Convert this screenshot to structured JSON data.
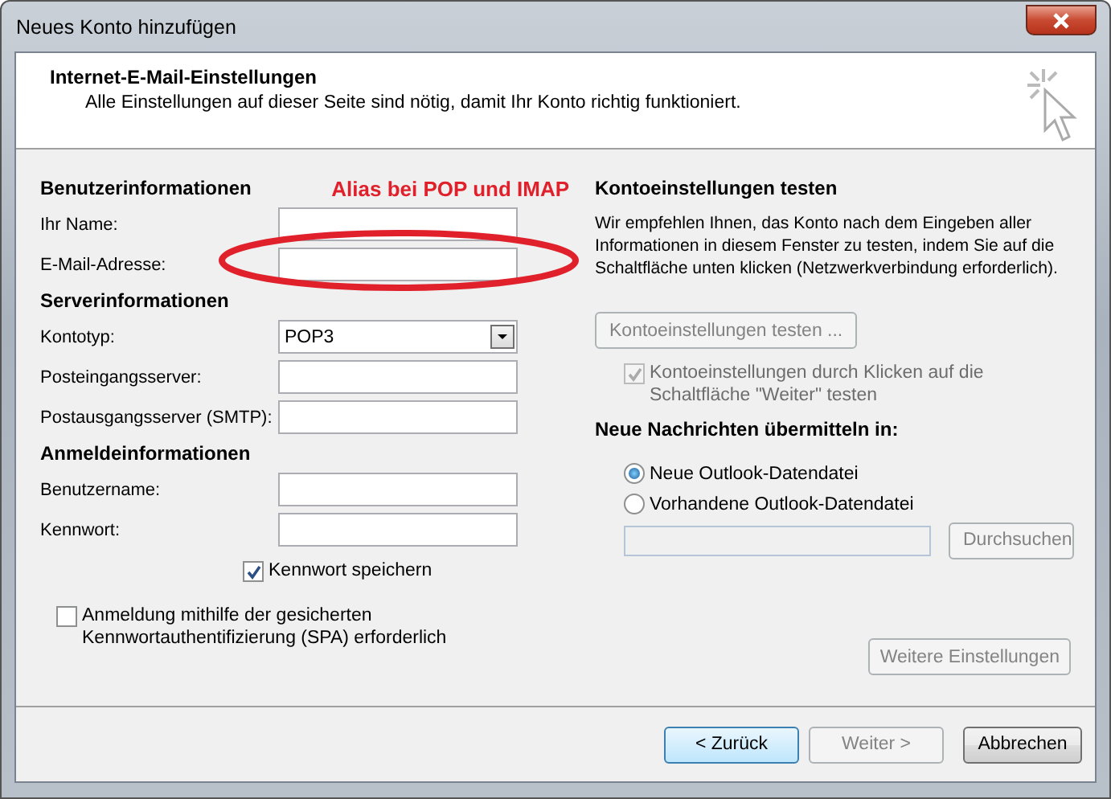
{
  "window": {
    "title": "Neues Konto hinzufügen"
  },
  "header": {
    "title": "Internet-E-Mail-Einstellungen",
    "subtitle": "Alle Einstellungen auf dieser Seite sind nötig, damit Ihr Konto richtig funktioniert."
  },
  "annotation": {
    "text": "Alias bei POP und IMAP"
  },
  "left_sections": [
    {
      "heading": "Benutzerinformationen",
      "fields": [
        {
          "label": "Ihr Name:",
          "kind": "text",
          "highlighted": false
        },
        {
          "label": "E-Mail-Adresse:",
          "kind": "text",
          "highlighted": true
        }
      ]
    },
    {
      "heading": "Serverinformationen",
      "fields": [
        {
          "label": "Kontotyp:",
          "kind": "select",
          "value": "POP3",
          "highlighted": false
        },
        {
          "label": "Posteingangsserver:",
          "kind": "text",
          "highlighted": false
        },
        {
          "label": "Postausgangsserver (SMTP):",
          "kind": "text",
          "highlighted": false
        }
      ]
    },
    {
      "heading": "Anmeldeinformationen",
      "fields": [
        {
          "label": "Benutzername:",
          "kind": "text",
          "highlighted": false
        },
        {
          "label": "Kennwort:",
          "kind": "text",
          "highlighted": false
        }
      ]
    }
  ],
  "save_password": {
    "label": "Kennwort speichern",
    "checked": true
  },
  "spa": {
    "label": "Anmeldung mithilfe der gesicherten Kennwortauthentifizierung (SPA) erforderlich",
    "checked": false
  },
  "right": {
    "heading": "Kontoeinstellungen testen",
    "description": "Wir empfehlen Ihnen, das Konto nach dem Eingeben aller Informationen in diesem Fenster zu testen, indem Sie auf die Schaltfläche unten klicken (Netzwerkverbindung erforderlich).",
    "test_button": {
      "label": "Kontoeinstellungen testen ...",
      "disabled": true
    },
    "test_checkbox": {
      "label": "Kontoeinstellungen durch Klicken auf die Schaltfläche \"Weiter\" testen",
      "checked": true,
      "disabled": true
    },
    "delivery_heading": "Neue Nachrichten übermitteln in:",
    "radios": [
      {
        "label": "Neue Outlook-Datendatei",
        "selected": true
      },
      {
        "label": "Vorhandene Outlook-Datendatei",
        "selected": false
      }
    ],
    "browse_button": {
      "label": "Durchsuchen",
      "disabled": true
    },
    "more_button": {
      "label": "Weitere Einstellungen",
      "disabled": true
    }
  },
  "footer_buttons": [
    {
      "label": "< Zurück",
      "disabled": false,
      "default": true
    },
    {
      "label": "Weiter >",
      "disabled": true,
      "default": false
    },
    {
      "label": "Abbrechen",
      "disabled": false,
      "default": false
    }
  ]
}
